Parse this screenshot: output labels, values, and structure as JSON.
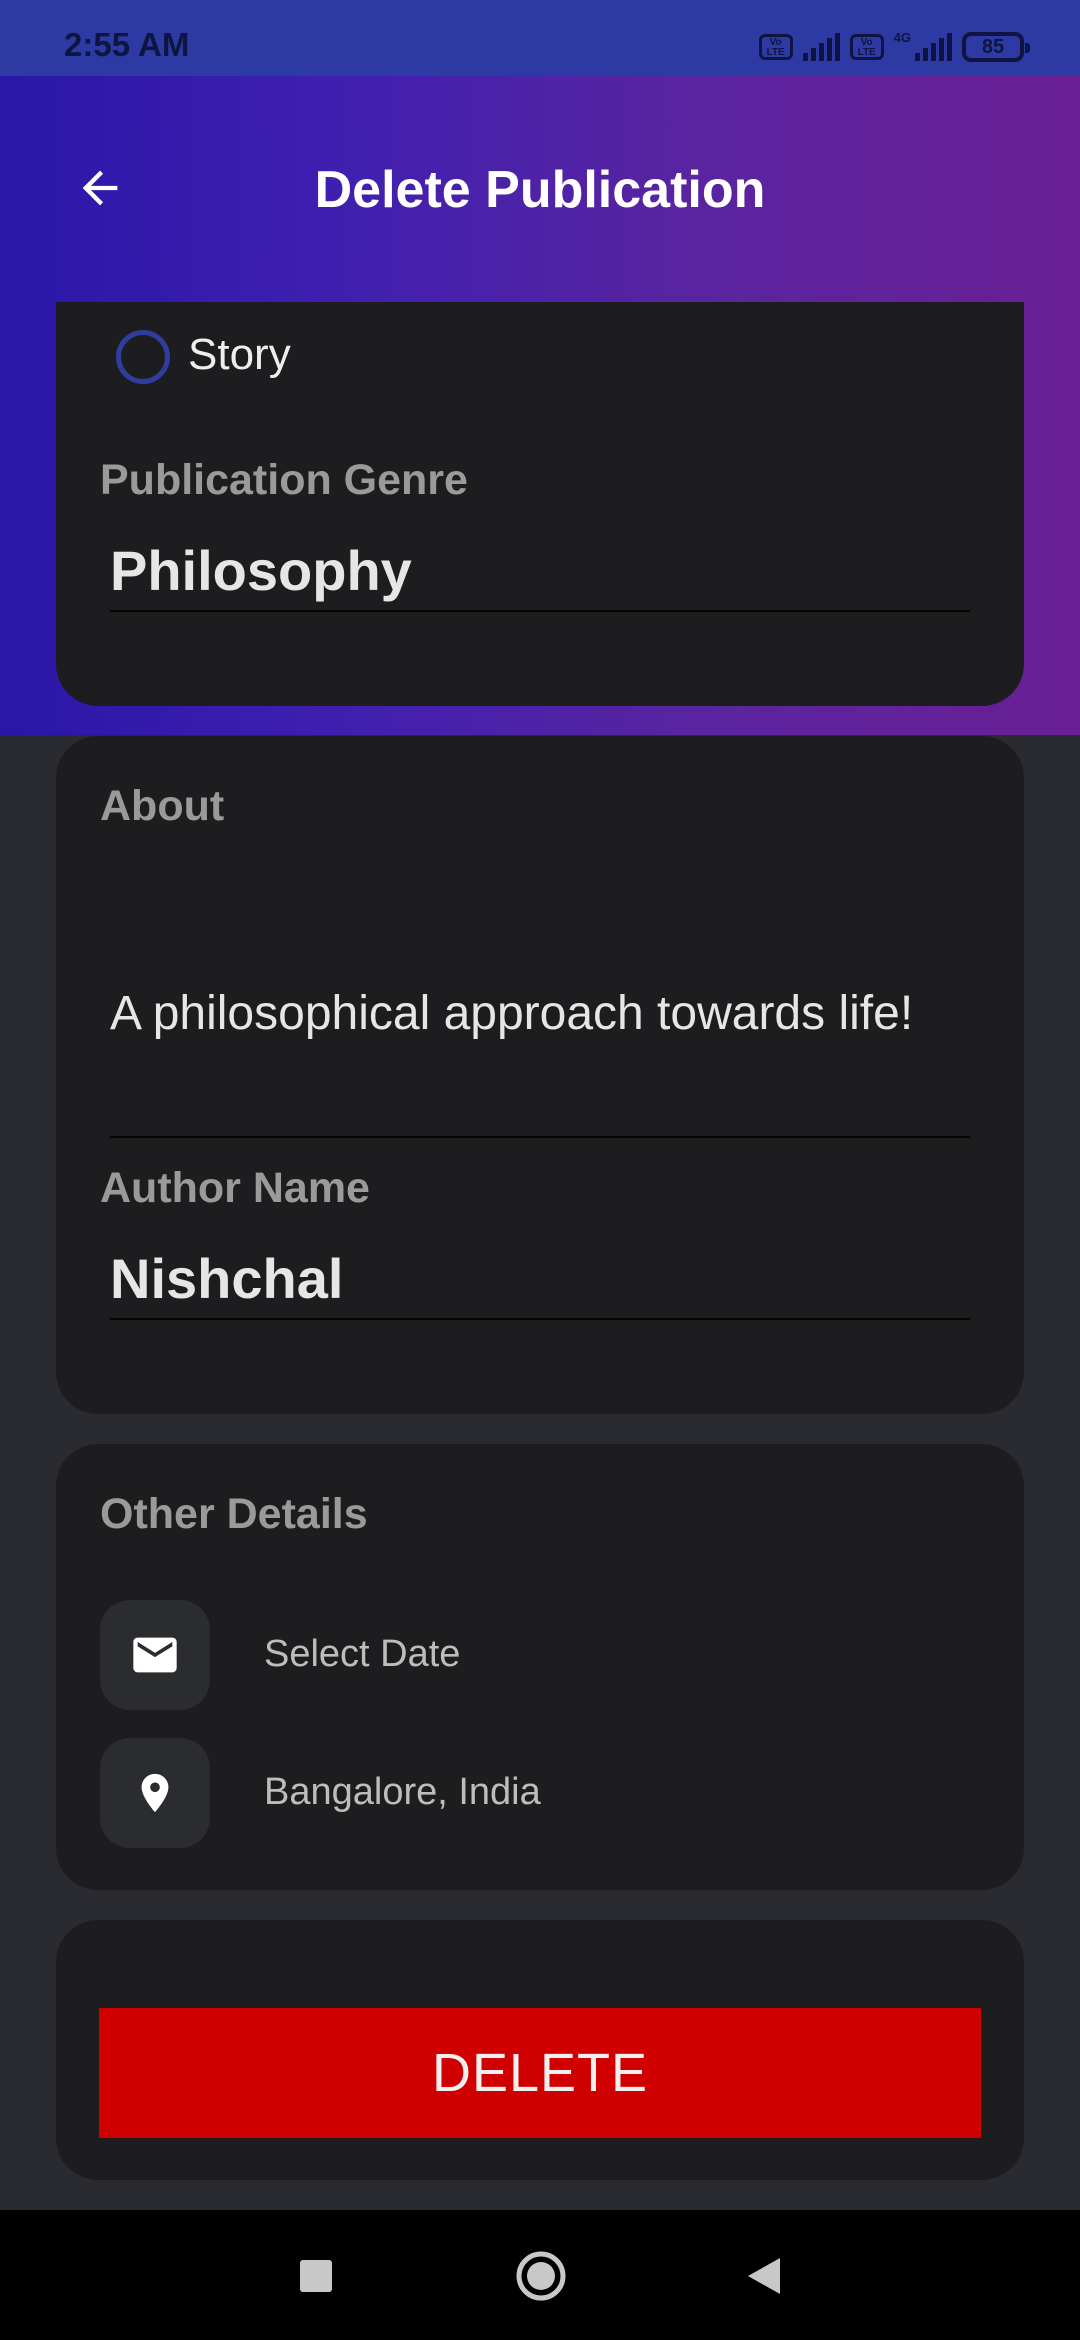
{
  "status_bar": {
    "time": "2:55 AM",
    "volte_label": "Vo LTE",
    "network_label": "4G",
    "battery": "85"
  },
  "header": {
    "title": "Delete Publication"
  },
  "publication_type": {
    "option_label": "Story"
  },
  "genre": {
    "label": "Publication Genre",
    "value": "Philosophy"
  },
  "about": {
    "label": "About",
    "value": "A philosophical approach towards life!"
  },
  "author": {
    "label": "Author Name",
    "value": "Nishchal"
  },
  "other_details": {
    "label": "Other Details",
    "date_text": "Select Date",
    "date_icon": "mail-icon",
    "location_text": "Bangalore, India",
    "location_icon": "location-pin-icon"
  },
  "actions": {
    "delete_label": "DELETE",
    "delete_color": "#d10000"
  },
  "colors": {
    "header_gradient_start": "#2a16a8",
    "header_gradient_end": "#6a1f94",
    "card_bg": "#1d1d1f",
    "page_bg": "#2a2b30"
  }
}
